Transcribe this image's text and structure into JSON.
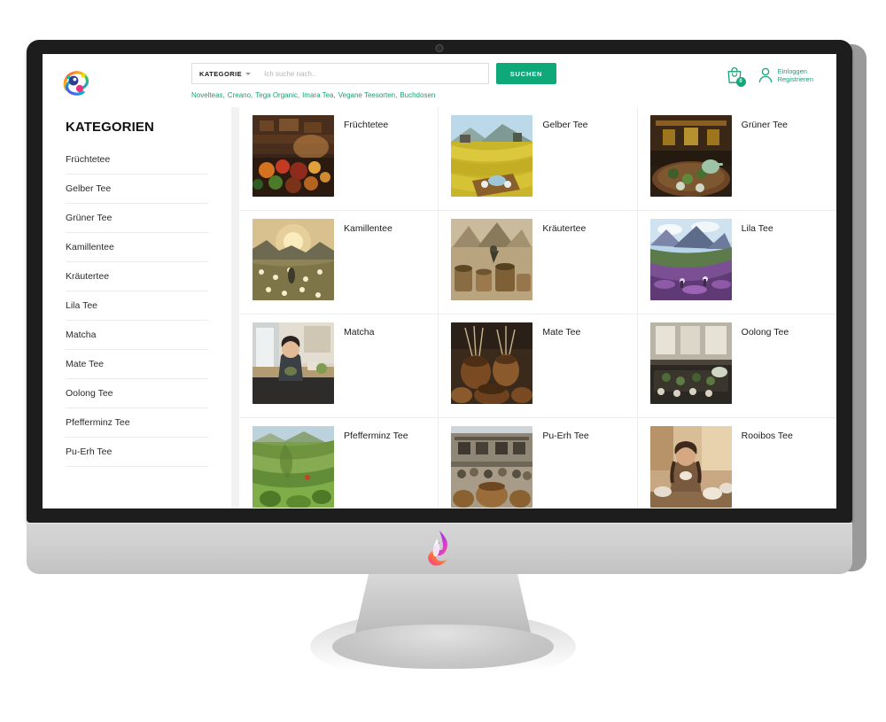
{
  "header": {
    "logo_icon": "brand-logo-colorful",
    "category_label": "KATEGORIE",
    "search_placeholder": "Ich suche nach..",
    "search_value": "",
    "search_button": "SUCHEN",
    "quick_links": [
      "Novelteas,",
      "Creano,",
      "Tega Organic,",
      "Imara Tea,",
      "Vegane Teesorten,",
      "Buchdosen"
    ],
    "cart": {
      "icon": "shopping-bag-smile-icon",
      "count": "0"
    },
    "account": {
      "icon": "user-icon",
      "line1": "Einloggen",
      "line2": "Registrieren"
    }
  },
  "sidebar": {
    "title": "KATEGORIEN",
    "items": [
      "Früchtetee",
      "Gelber Tee",
      "Grüner Tee",
      "Kamillentee",
      "Kräutertee",
      "Lila Tee",
      "Matcha",
      "Mate Tee",
      "Oolong Tee",
      "Pfefferminz Tee",
      "Pu-Erh Tee"
    ]
  },
  "grid": {
    "tiles": [
      {
        "label": "Früchtetee",
        "thumb": "dried-fruit-tea-table"
      },
      {
        "label": "Gelber Tee",
        "thumb": "yellow-tea-field"
      },
      {
        "label": "Grüner Tee",
        "thumb": "green-tea-interior"
      },
      {
        "label": "Kamillentee",
        "thumb": "chamomile-field-sunset"
      },
      {
        "label": "Kräutertee",
        "thumb": "herbal-mountain-barrels"
      },
      {
        "label": "Lila Tee",
        "thumb": "purple-tea-valley"
      },
      {
        "label": "Matcha",
        "thumb": "matcha-cafe-woman"
      },
      {
        "label": "Mate Tee",
        "thumb": "mate-gourds"
      },
      {
        "label": "Oolong Tee",
        "thumb": "oolong-tea-room"
      },
      {
        "label": "Pfefferminz Tee",
        "thumb": "mint-terraces"
      },
      {
        "label": "Pu-Erh Tee",
        "thumb": "puerh-market-street"
      },
      {
        "label": "Rooibos Tee",
        "thumb": "rooibos-woman-tea"
      }
    ]
  },
  "monitor": {
    "chin_logo": "phoenix-flame-logo",
    "webcam": "webcam-dot"
  },
  "colors": {
    "brand_green": "#0fa878",
    "link_green": "#17a178",
    "bezel": "#1d1d1d",
    "chin": "#cfcfcf",
    "divider": "#ededed"
  }
}
